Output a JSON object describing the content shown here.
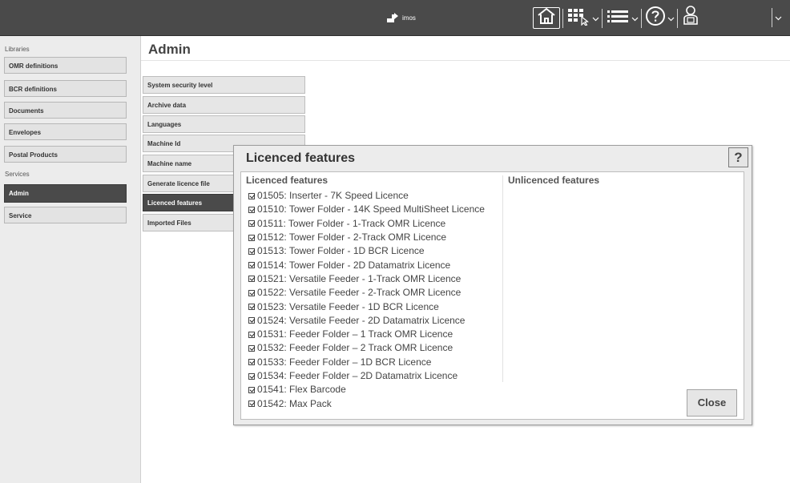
{
  "header": {
    "logo_text": "imos",
    "icons": [
      "home-icon",
      "grid-cursor-icon",
      "list-menu-icon",
      "help-circle-icon",
      "user-card-icon"
    ]
  },
  "sidebar": {
    "libraries_heading": "Libraries",
    "library_items": [
      {
        "label": "OMR definitions"
      },
      {
        "label": "BCR definitions"
      },
      {
        "label": "Documents"
      },
      {
        "label": "Envelopes"
      },
      {
        "label": "Postal Products"
      }
    ],
    "services_heading": "Services",
    "service_items": [
      {
        "label": "Admin",
        "active": true
      },
      {
        "label": "Service",
        "active": false
      }
    ]
  },
  "main": {
    "title": "Admin",
    "menu": [
      {
        "label": "System security level"
      },
      {
        "label": "Archive data"
      },
      {
        "label": "Languages"
      },
      {
        "label": "Machine Id"
      },
      {
        "label": "Machine name"
      },
      {
        "label": "Generate licence file"
      },
      {
        "label": "Licenced features",
        "active": true
      },
      {
        "label": "Imported Files"
      }
    ]
  },
  "dialog": {
    "title": "Licenced features",
    "help_label": "?",
    "licenced_heading": "Licenced features",
    "unlicenced_heading": "Unlicenced features",
    "licenced_features": [
      "01505: Inserter - 7K Speed Licence",
      "01510: Tower Folder - 14K Speed MultiSheet Licence",
      "01511: Tower Folder - 1-Track OMR Licence",
      "01512: Tower Folder - 2-Track OMR Licence",
      "01513: Tower Folder - 1D BCR Licence",
      "01514: Tower Folder - 2D Datamatrix Licence",
      "01521: Versatile Feeder - 1-Track OMR Licence",
      "01522: Versatile Feeder - 2-Track OMR Licence",
      "01523: Versatile Feeder - 1D BCR Licence",
      "01524: Versatile Feeder - 2D Datamatrix Licence",
      "01531: Feeder Folder – 1 Track OMR Licence",
      "01532: Feeder Folder – 2 Track OMR Licence",
      "01533: Feeder Folder – 1D BCR Licence",
      "01534: Feeder Folder – 2D Datamatrix Licence",
      "01541: Flex Barcode",
      "01542: Max Pack"
    ],
    "unlicenced_features": [],
    "close_label": "Close"
  }
}
